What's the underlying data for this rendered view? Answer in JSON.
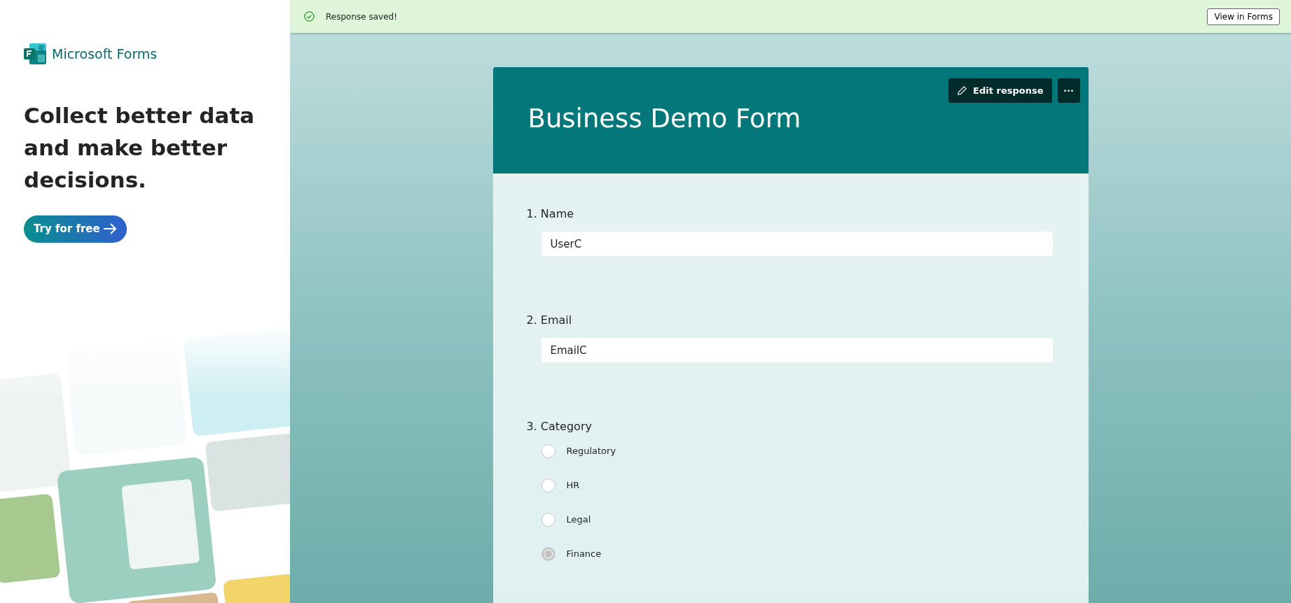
{
  "promo": {
    "brand": "Microsoft Forms",
    "headline": "Collect better data and make better decisions.",
    "cta": "Try for free"
  },
  "banner": {
    "message": "Response saved!",
    "action": "View in Forms"
  },
  "form": {
    "title": "Business Demo Form",
    "edit_button": "Edit response",
    "more_button": "···",
    "questions": [
      {
        "kind": "text",
        "label": "1. Name",
        "value": "UserC"
      },
      {
        "kind": "text",
        "label": "2. Email",
        "value": "EmailC"
      },
      {
        "kind": "choice",
        "label": "3. Category",
        "options": [
          {
            "label": "Regulatory",
            "selected": false
          },
          {
            "label": "HR",
            "selected": false
          },
          {
            "label": "Legal",
            "selected": false
          },
          {
            "label": "Finance",
            "selected": true
          }
        ]
      }
    ]
  }
}
